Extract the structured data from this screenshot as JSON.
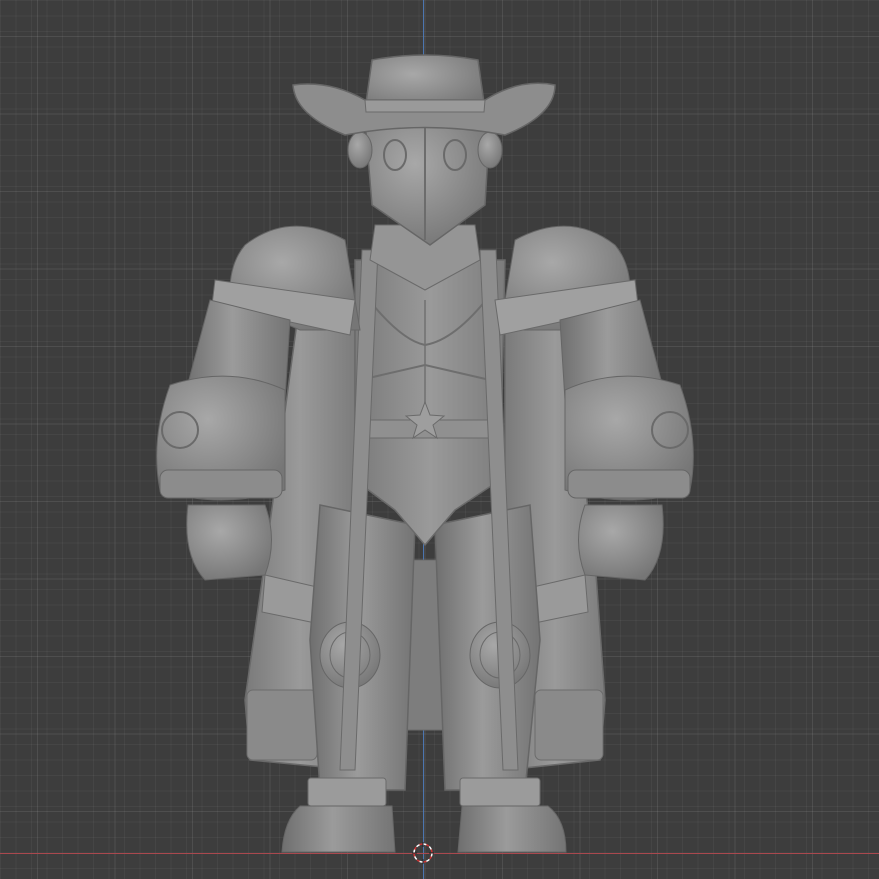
{
  "viewport": {
    "background": "#3d3d3d",
    "grid_visible": true,
    "axis_colors": {
      "x": "#b5484f",
      "z": "#4d7fc4"
    }
  },
  "model": {
    "shading": "solid",
    "base_color": "#8c8c8c",
    "subject": "cowboy-robot-character-sculpt"
  },
  "cursor": {
    "icon": "3d-cursor-icon",
    "colors": [
      "#cc3333",
      "#ffffff"
    ]
  }
}
